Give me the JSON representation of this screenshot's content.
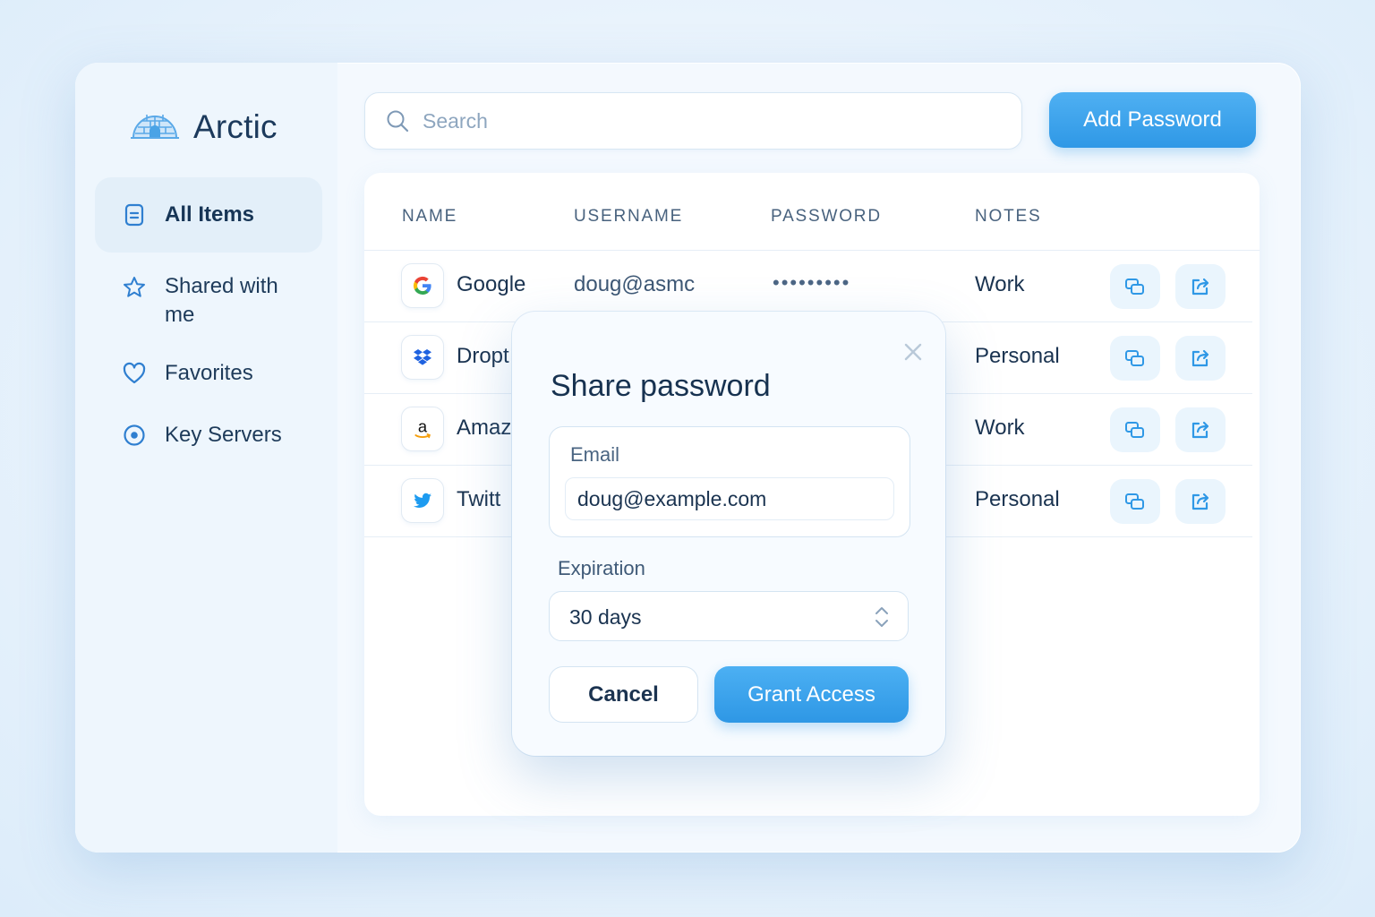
{
  "app": {
    "name": "Arctic",
    "logo_icon": "igloo-icon"
  },
  "sidebar": {
    "items": [
      {
        "label": "All Items",
        "icon": "document-icon",
        "active": true
      },
      {
        "label": "Shared with me",
        "icon": "star-icon",
        "active": false
      },
      {
        "label": "Favorites",
        "icon": "heart-icon",
        "active": false
      },
      {
        "label": "Key Servers",
        "icon": "location-pin-icon",
        "active": false
      }
    ]
  },
  "search": {
    "placeholder": "Search",
    "value": ""
  },
  "toolbar": {
    "add_label": "Add Password"
  },
  "table": {
    "columns": [
      "NAME",
      "USERNAME",
      "PASSWORD",
      "NOTES"
    ],
    "rows": [
      {
        "name": "Google",
        "username": "doug@asmc",
        "password": "•••••••••",
        "notes": "Work",
        "logo": "google-logo-icon"
      },
      {
        "name": "Dropt",
        "username": "",
        "password": "",
        "notes": "Personal",
        "logo": "dropbox-logo-icon"
      },
      {
        "name": "Amaz",
        "username": "",
        "password": "",
        "notes": "Work",
        "logo": "amazon-logo-icon"
      },
      {
        "name": "Twitt",
        "username": "",
        "password": "",
        "notes": "Personal",
        "logo": "twitter-logo-icon"
      }
    ],
    "row_actions": [
      "copy-icon",
      "share-icon"
    ]
  },
  "modal": {
    "title": "Share password",
    "email_label": "Email",
    "email_value": "doug@example.com",
    "expiration_label": "Expiration",
    "expiration_value": "30 days",
    "cancel_label": "Cancel",
    "grant_label": "Grant Access"
  },
  "colors": {
    "accent": "#2f98e6",
    "background": "#eaf4fc",
    "text": "#17324d"
  }
}
